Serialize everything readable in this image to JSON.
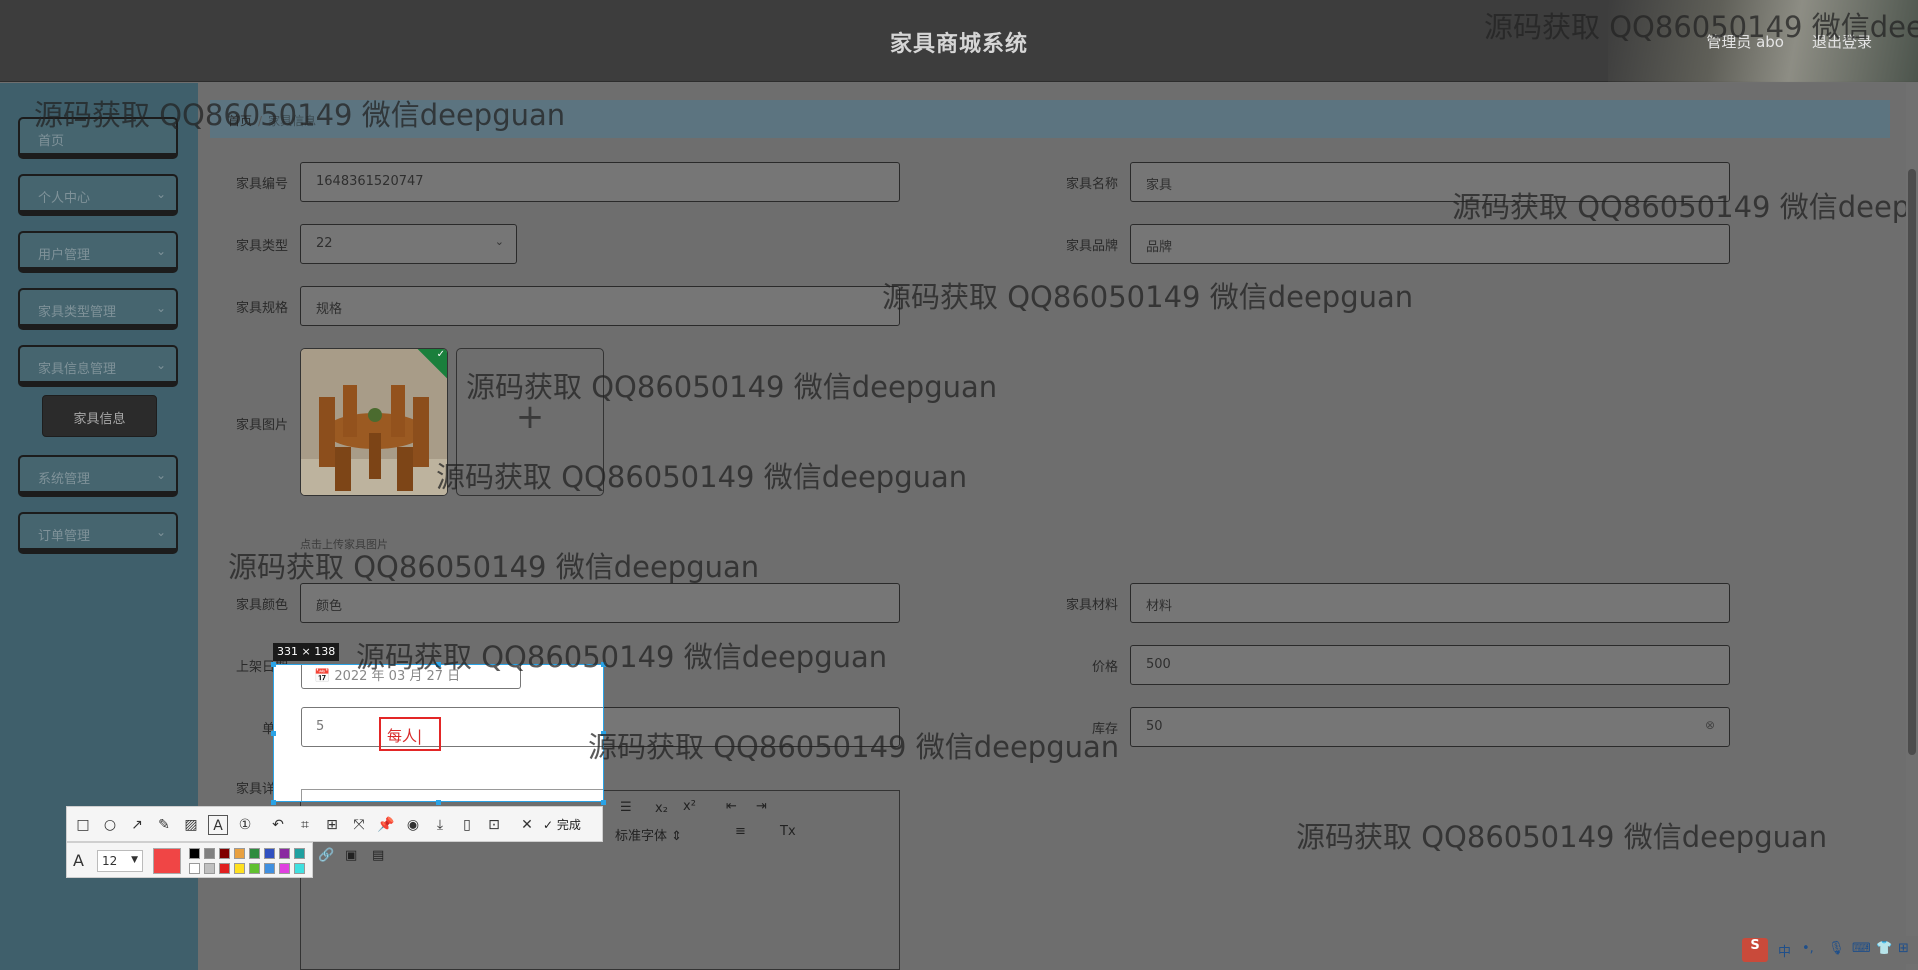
{
  "header": {
    "title": "家具商城系统",
    "user_label": "管理员 abo",
    "logout": "退出登录"
  },
  "sidebar": {
    "items": [
      {
        "label": "首页",
        "has_chevron": false
      },
      {
        "label": "个人中心",
        "has_chevron": true
      },
      {
        "label": "用户管理",
        "has_chevron": true
      },
      {
        "label": "家具类型管理",
        "has_chevron": true
      },
      {
        "label": "家具信息管理",
        "has_chevron": true
      },
      {
        "label": "系统管理",
        "has_chevron": true
      },
      {
        "label": "订单管理",
        "has_chevron": true
      }
    ],
    "active_sub": "家具信息"
  },
  "breadcrumb": {
    "home": "首页",
    "current": "家具信息"
  },
  "form": {
    "code": {
      "label": "家具编号",
      "value": "1648361520747"
    },
    "name": {
      "label": "家具名称",
      "value": "家具"
    },
    "type": {
      "label": "家具类型",
      "value": "22"
    },
    "brand": {
      "label": "家具品牌",
      "value": "品牌"
    },
    "spec": {
      "label": "家具规格",
      "value": "规格"
    },
    "image": {
      "label": "家具图片",
      "plus": "+",
      "hint": "点击上传家具图片"
    },
    "color": {
      "label": "家具颜色",
      "value": "颜色"
    },
    "material": {
      "label": "家具材料",
      "value": "材料"
    },
    "date": {
      "label": "上架日期",
      "value": "2022 年 03 月 27 日"
    },
    "price": {
      "label": "价格",
      "value": "500"
    },
    "limit": {
      "label": "单限",
      "value": "5"
    },
    "stock": {
      "label": "库存",
      "value": "50"
    },
    "detail": {
      "label": "家具详情"
    }
  },
  "editor": {
    "font_family": "标准字体",
    "sub": "x₂",
    "sup": "x²"
  },
  "screenshot_tool": {
    "dimensions": "331 × 138",
    "text_annotation": "每人",
    "done_label": "完成",
    "font_size": "12",
    "current_color": "#f04545",
    "palette": [
      "#000000",
      "#808080",
      "#800000",
      "#e8a040",
      "#2e8b3e",
      "#3050c0",
      "#8a2aa0",
      "#20a0a0",
      "#ffffff",
      "#c0c0c0",
      "#e02020",
      "#ffe020",
      "#60c030",
      "#4090e0",
      "#e040e0",
      "#40e0e0"
    ]
  },
  "watermark": "源码获取 QQ86050149 微信deepguan",
  "ime": {
    "lang": "中"
  }
}
